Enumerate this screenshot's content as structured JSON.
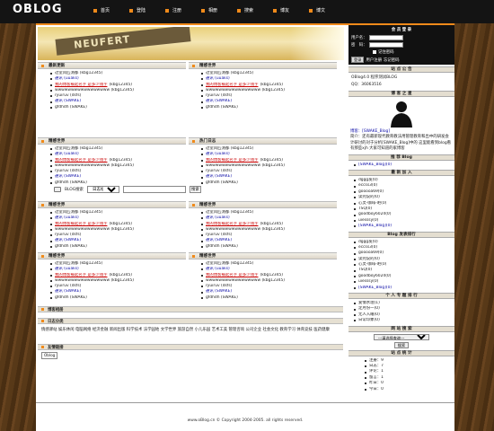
{
  "logo": "OBLOG",
  "nav": [
    "首页",
    "登陆",
    "注册",
    "相册",
    "搜索",
    "博友",
    "博文"
  ],
  "banner": {
    "text": "NEUFERT"
  },
  "login": {
    "title": "会 员 登 录",
    "user_label": "用户名：",
    "pass_label": "密　码：",
    "remember": "记住密码",
    "submit": "登录",
    "register": "用户注册",
    "forgot": "忘记密码"
  },
  "blocks": [
    {
      "title": "最新更新",
      "items": [
        {
          "text": "过室风匹测都 (kbg12345)",
          "style": "normal"
        },
        {
          "text": "通讯 (uuaks)",
          "style": "link"
        },
        {
          "text": "我的博客被起名字 是多少钱字",
          "style": "red",
          "suffix": "(kbg12345)"
        },
        {
          "text": "wwwwwwwwwwwwwwwww (kbg12345)",
          "style": "normal"
        },
        {
          "text": "ryuiruv (dsfs)",
          "style": "normal"
        },
        {
          "text": "通讯 (SWAKE)",
          "style": "link"
        },
        {
          "text": "gfdhdh (SWAKE)",
          "style": "normal"
        }
      ]
    },
    {
      "title": "精感世界",
      "items": [
        {
          "text": "过室风匹测都 (kbg12345)",
          "style": "normal"
        },
        {
          "text": "通讯 (uuaks)",
          "style": "link"
        },
        {
          "text": "我的博客被起名字 是多少钱字",
          "style": "red",
          "suffix": "(kbg12345)"
        },
        {
          "text": "wwwwwwwwwwwwwwwww (kbg12345)",
          "style": "normal"
        },
        {
          "text": "ryuiruv (dsfs)",
          "style": "normal"
        },
        {
          "text": "通讯 (SWAKE)",
          "style": "link"
        },
        {
          "text": "gfdhdh (SWAKE)",
          "style": "normal"
        }
      ]
    },
    {
      "title": "精感世界",
      "items": [
        {
          "text": "过室风匹测都 (kbg12345)",
          "style": "normal"
        },
        {
          "text": "通讯 (uuaks)",
          "style": "link"
        },
        {
          "text": "我的博客被起名字 是多少钱字",
          "style": "red",
          "suffix": "(kbg12345)"
        },
        {
          "text": "wwwwwwwwwwwwwwwww (kbg12345)",
          "style": "normal"
        },
        {
          "text": "ryuiruv (dsfs)",
          "style": "normal"
        },
        {
          "text": "通讯 (SWAKE)",
          "style": "link"
        },
        {
          "text": "gfdhdh (SWAKE)",
          "style": "normal"
        }
      ]
    },
    {
      "title": "热门日志",
      "items": [
        {
          "text": "过室风匹测都 (kbg12345)",
          "style": "normal"
        },
        {
          "text": "通讯 (uuaks)",
          "style": "link"
        },
        {
          "text": "我的博客被起名字 是多少钱字",
          "style": "red",
          "suffix": "(kbg12345)"
        },
        {
          "text": "wwwwwwwwwwwwwwwww (kbg12345)",
          "style": "normal"
        },
        {
          "text": "ryuiruv (dsfs)",
          "style": "normal"
        },
        {
          "text": "通讯 (SWAKE)",
          "style": "link"
        },
        {
          "text": "gfdhdh (SWAKE)",
          "style": "normal"
        }
      ]
    },
    {
      "title": "精感世界",
      "items": [
        {
          "text": "过室风匹测都 (kbg12345)",
          "style": "normal"
        },
        {
          "text": "通讯 (uuaks)",
          "style": "link"
        },
        {
          "text": "我的博客被起名字 是多少钱字",
          "style": "red",
          "suffix": "(kbg12345)"
        },
        {
          "text": "wwwwwwwwwwwwwwwww (kbg12345)",
          "style": "normal"
        },
        {
          "text": "ryuiruv (dsfs)",
          "style": "normal"
        },
        {
          "text": "通讯 (SWAKE)",
          "style": "link"
        },
        {
          "text": "gfdhdh (SWAKE)",
          "style": "normal"
        }
      ]
    },
    {
      "title": "精感世界",
      "items": [
        {
          "text": "过室风匹测都 (kbg12345)",
          "style": "normal"
        },
        {
          "text": "通讯 (uuaks)",
          "style": "link"
        },
        {
          "text": "我的博客被起名字 是多少钱字",
          "style": "red",
          "suffix": "(kbg12345)"
        },
        {
          "text": "wwwwwwwwwwwwwwwww (kbg12345)",
          "style": "normal"
        },
        {
          "text": "ryuiruv (dsfs)",
          "style": "normal"
        },
        {
          "text": "通讯 (SWAKE)",
          "style": "link"
        },
        {
          "text": "gfdhdh (SWAKE)",
          "style": "normal"
        }
      ]
    },
    {
      "title": "精感世界",
      "items": [
        {
          "text": "过室风匹测都 (kbg12345)",
          "style": "normal"
        },
        {
          "text": "通讯 (uuaks)",
          "style": "link"
        },
        {
          "text": "我的博客被起名字 是多少钱字",
          "style": "red",
          "suffix": "(kbg12345)"
        },
        {
          "text": "wwwwwwwwwwwwwwwww (kbg12345)",
          "style": "normal"
        },
        {
          "text": "ryuiruv (dsfs)",
          "style": "normal"
        },
        {
          "text": "通讯 (SWAKE)",
          "style": "link"
        },
        {
          "text": "gfdhdh (SWAKE)",
          "style": "normal"
        }
      ]
    },
    {
      "title": "精感世界",
      "items": [
        {
          "text": "过室风匹测都 (kbg12345)",
          "style": "normal"
        },
        {
          "text": "通讯 (uuaks)",
          "style": "link"
        },
        {
          "text": "我的博客被起名字 是多少钱字",
          "style": "red",
          "suffix": "(kbg12345)"
        },
        {
          "text": "wwwwwwwwwwwwwwwww (kbg12345)",
          "style": "normal"
        },
        {
          "text": "ryuiruv (dsfs)",
          "style": "normal"
        },
        {
          "text": "通讯 (SWAKE)",
          "style": "link"
        },
        {
          "text": "gfdhdh (SWAKE)",
          "style": "normal"
        }
      ]
    }
  ],
  "search": {
    "label": "BLOG搜索",
    "select": "日志标题",
    "button": "搜索"
  },
  "sections": {
    "photo": "博客相册",
    "cats": "日志分类",
    "links": "友情链接"
  },
  "categories": "情感驿站 娱乐休闲 电脑网络 经济金融 新闻出版 科学技术 法学园地 文学世界 旅游自然 小儿乐园 艺术工美 管理咨询 公司企业 社会文化 教育学习 体育竞技 医药健康",
  "friend_link": "Oblog",
  "side": {
    "announce_title": "站 点 公 告",
    "announce": [
      "OBlog4.0 程序测试BLOG",
      "QQ：36063516"
    ],
    "star_title": "博 客 之 星",
    "star_lines": [
      "博客：[SWAKE_Blog]",
      "简介：还有最新现代教育教法用管理教育和出中的研发会计研讨的对于分析[SWAKE_Blog]中的 这里能看到blog看有那些xjh 大家可知道的家博客"
    ],
    "tuijian_title": "推 荐 Blog",
    "tuijian": [
      "[SWAKE_Blog](0)"
    ],
    "newuser_title": "最 新 加 入",
    "newusers": [
      "dggg发(0)",
      "eccss3(0)",
      "gooooa69(0)",
      "读兜说的(0)",
      "心灵-咖啡-吧(0)",
      "TSQ(0)",
      "goodboy6024(0)",
      "uiesssy(0)",
      "[SWAKE_Blog](0)"
    ],
    "rank_title": "Blog 发表排行",
    "rank": [
      "dggg发(0)",
      "eccss3(0)",
      "gooooa69(0)",
      "读兜说的(0)",
      "心灵-咖啡-吧(0)",
      "TSQ(0)",
      "goodboy6024(0)",
      "uiesssy(0)",
      "[SWAKE_Blog](0)"
    ],
    "topic_title": "个 人 专 题 排 行",
    "topics": [
      "爱情水理(1)",
      "定月份一(0)",
      "无人入睡(0)",
      "日常印象(0)"
    ],
    "site_search_title": "网 站 搜 索",
    "site_search_select": "---请选择查询---",
    "site_search_btn": "搜索",
    "stats_title": "站 点 统 计",
    "stats": [
      "注册：9",
      "日志：7",
      "评论：1",
      "留言：1",
      "昨日：0",
      "今日：0"
    ]
  },
  "footer": "www.oBlog.cn © Copyright 2004-2005. all rights reserved.",
  "colors": {
    "accent": "#f08a1a",
    "link": "#0a0aa6",
    "red": "#c80000"
  }
}
